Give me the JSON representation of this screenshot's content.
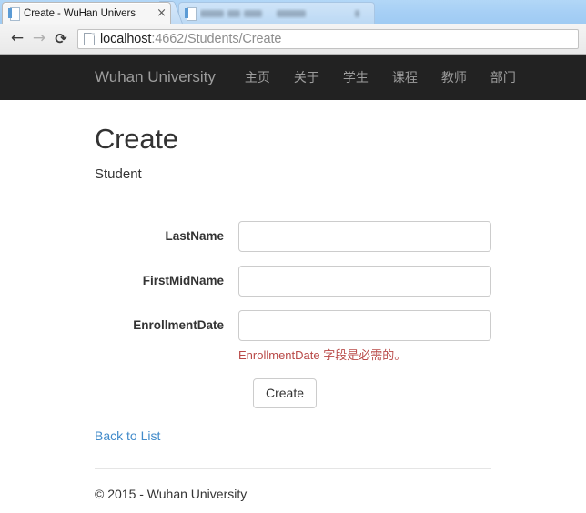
{
  "browser": {
    "tabs": [
      {
        "title": "Create - WuHan Univers",
        "close_label": "×",
        "active": true
      },
      {
        "title": "",
        "close_label": "×",
        "active": false
      }
    ],
    "toolbar": {
      "back_icon": "←",
      "forward_icon": "→",
      "reload_icon": "⟳",
      "url_host": "localhost",
      "url_rest": ":4662/Students/Create"
    }
  },
  "site": {
    "brand": "Wuhan University",
    "nav": [
      {
        "label": "主页"
      },
      {
        "label": "关于"
      },
      {
        "label": "学生"
      },
      {
        "label": "课程"
      },
      {
        "label": "教师"
      },
      {
        "label": "部门"
      }
    ]
  },
  "page": {
    "title": "Create",
    "subtitle": "Student",
    "form": {
      "fields": [
        {
          "label": "LastName",
          "value": "",
          "placeholder": "",
          "error": ""
        },
        {
          "label": "FirstMidName",
          "value": "",
          "placeholder": "",
          "error": ""
        },
        {
          "label": "EnrollmentDate",
          "value": "",
          "placeholder": "",
          "error": "EnrollmentDate 字段是必需的。"
        }
      ],
      "submit_label": "Create"
    },
    "back_link": "Back to List",
    "footer": "© 2015 - Wuhan University"
  },
  "colors": {
    "navbar_bg": "#222222",
    "nav_text": "#9d9d9d",
    "link": "#428bca",
    "error": "#b94a48",
    "input_border": "#cccccc"
  }
}
